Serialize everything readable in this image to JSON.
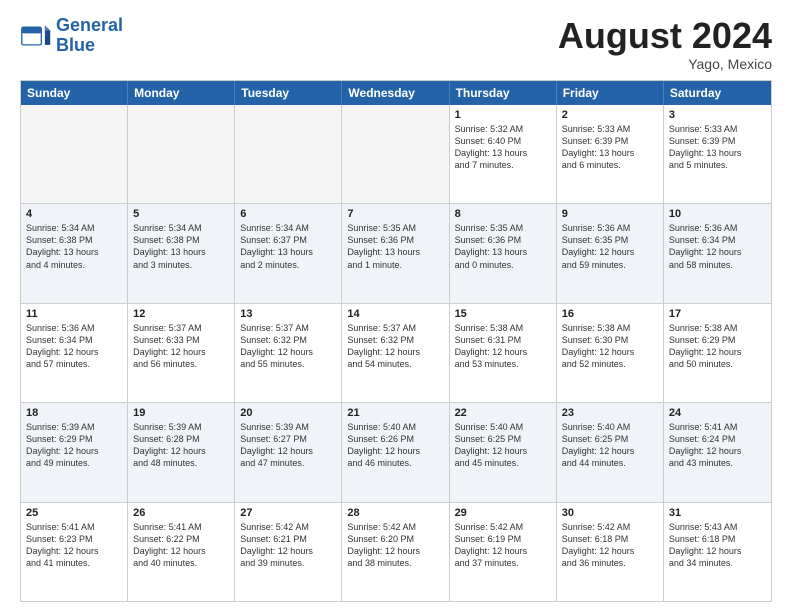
{
  "logo": {
    "line1": "General",
    "line2": "Blue"
  },
  "title": "August 2024",
  "location": "Yago, Mexico",
  "header": {
    "days": [
      "Sunday",
      "Monday",
      "Tuesday",
      "Wednesday",
      "Thursday",
      "Friday",
      "Saturday"
    ]
  },
  "rows": [
    [
      {
        "day": "",
        "text": "",
        "empty": true
      },
      {
        "day": "",
        "text": "",
        "empty": true
      },
      {
        "day": "",
        "text": "",
        "empty": true
      },
      {
        "day": "",
        "text": "",
        "empty": true
      },
      {
        "day": "1",
        "text": "Sunrise: 5:32 AM\nSunset: 6:40 PM\nDaylight: 13 hours\nand 7 minutes."
      },
      {
        "day": "2",
        "text": "Sunrise: 5:33 AM\nSunset: 6:39 PM\nDaylight: 13 hours\nand 6 minutes."
      },
      {
        "day": "3",
        "text": "Sunrise: 5:33 AM\nSunset: 6:39 PM\nDaylight: 13 hours\nand 5 minutes."
      }
    ],
    [
      {
        "day": "4",
        "text": "Sunrise: 5:34 AM\nSunset: 6:38 PM\nDaylight: 13 hours\nand 4 minutes."
      },
      {
        "day": "5",
        "text": "Sunrise: 5:34 AM\nSunset: 6:38 PM\nDaylight: 13 hours\nand 3 minutes."
      },
      {
        "day": "6",
        "text": "Sunrise: 5:34 AM\nSunset: 6:37 PM\nDaylight: 13 hours\nand 2 minutes."
      },
      {
        "day": "7",
        "text": "Sunrise: 5:35 AM\nSunset: 6:36 PM\nDaylight: 13 hours\nand 1 minute."
      },
      {
        "day": "8",
        "text": "Sunrise: 5:35 AM\nSunset: 6:36 PM\nDaylight: 13 hours\nand 0 minutes."
      },
      {
        "day": "9",
        "text": "Sunrise: 5:36 AM\nSunset: 6:35 PM\nDaylight: 12 hours\nand 59 minutes."
      },
      {
        "day": "10",
        "text": "Sunrise: 5:36 AM\nSunset: 6:34 PM\nDaylight: 12 hours\nand 58 minutes."
      }
    ],
    [
      {
        "day": "11",
        "text": "Sunrise: 5:36 AM\nSunset: 6:34 PM\nDaylight: 12 hours\nand 57 minutes."
      },
      {
        "day": "12",
        "text": "Sunrise: 5:37 AM\nSunset: 6:33 PM\nDaylight: 12 hours\nand 56 minutes."
      },
      {
        "day": "13",
        "text": "Sunrise: 5:37 AM\nSunset: 6:32 PM\nDaylight: 12 hours\nand 55 minutes."
      },
      {
        "day": "14",
        "text": "Sunrise: 5:37 AM\nSunset: 6:32 PM\nDaylight: 12 hours\nand 54 minutes."
      },
      {
        "day": "15",
        "text": "Sunrise: 5:38 AM\nSunset: 6:31 PM\nDaylight: 12 hours\nand 53 minutes."
      },
      {
        "day": "16",
        "text": "Sunrise: 5:38 AM\nSunset: 6:30 PM\nDaylight: 12 hours\nand 52 minutes."
      },
      {
        "day": "17",
        "text": "Sunrise: 5:38 AM\nSunset: 6:29 PM\nDaylight: 12 hours\nand 50 minutes."
      }
    ],
    [
      {
        "day": "18",
        "text": "Sunrise: 5:39 AM\nSunset: 6:29 PM\nDaylight: 12 hours\nand 49 minutes."
      },
      {
        "day": "19",
        "text": "Sunrise: 5:39 AM\nSunset: 6:28 PM\nDaylight: 12 hours\nand 48 minutes."
      },
      {
        "day": "20",
        "text": "Sunrise: 5:39 AM\nSunset: 6:27 PM\nDaylight: 12 hours\nand 47 minutes."
      },
      {
        "day": "21",
        "text": "Sunrise: 5:40 AM\nSunset: 6:26 PM\nDaylight: 12 hours\nand 46 minutes."
      },
      {
        "day": "22",
        "text": "Sunrise: 5:40 AM\nSunset: 6:25 PM\nDaylight: 12 hours\nand 45 minutes."
      },
      {
        "day": "23",
        "text": "Sunrise: 5:40 AM\nSunset: 6:25 PM\nDaylight: 12 hours\nand 44 minutes."
      },
      {
        "day": "24",
        "text": "Sunrise: 5:41 AM\nSunset: 6:24 PM\nDaylight: 12 hours\nand 43 minutes."
      }
    ],
    [
      {
        "day": "25",
        "text": "Sunrise: 5:41 AM\nSunset: 6:23 PM\nDaylight: 12 hours\nand 41 minutes."
      },
      {
        "day": "26",
        "text": "Sunrise: 5:41 AM\nSunset: 6:22 PM\nDaylight: 12 hours\nand 40 minutes."
      },
      {
        "day": "27",
        "text": "Sunrise: 5:42 AM\nSunset: 6:21 PM\nDaylight: 12 hours\nand 39 minutes."
      },
      {
        "day": "28",
        "text": "Sunrise: 5:42 AM\nSunset: 6:20 PM\nDaylight: 12 hours\nand 38 minutes."
      },
      {
        "day": "29",
        "text": "Sunrise: 5:42 AM\nSunset: 6:19 PM\nDaylight: 12 hours\nand 37 minutes."
      },
      {
        "day": "30",
        "text": "Sunrise: 5:42 AM\nSunset: 6:18 PM\nDaylight: 12 hours\nand 36 minutes."
      },
      {
        "day": "31",
        "text": "Sunrise: 5:43 AM\nSunset: 6:18 PM\nDaylight: 12 hours\nand 34 minutes."
      }
    ]
  ]
}
